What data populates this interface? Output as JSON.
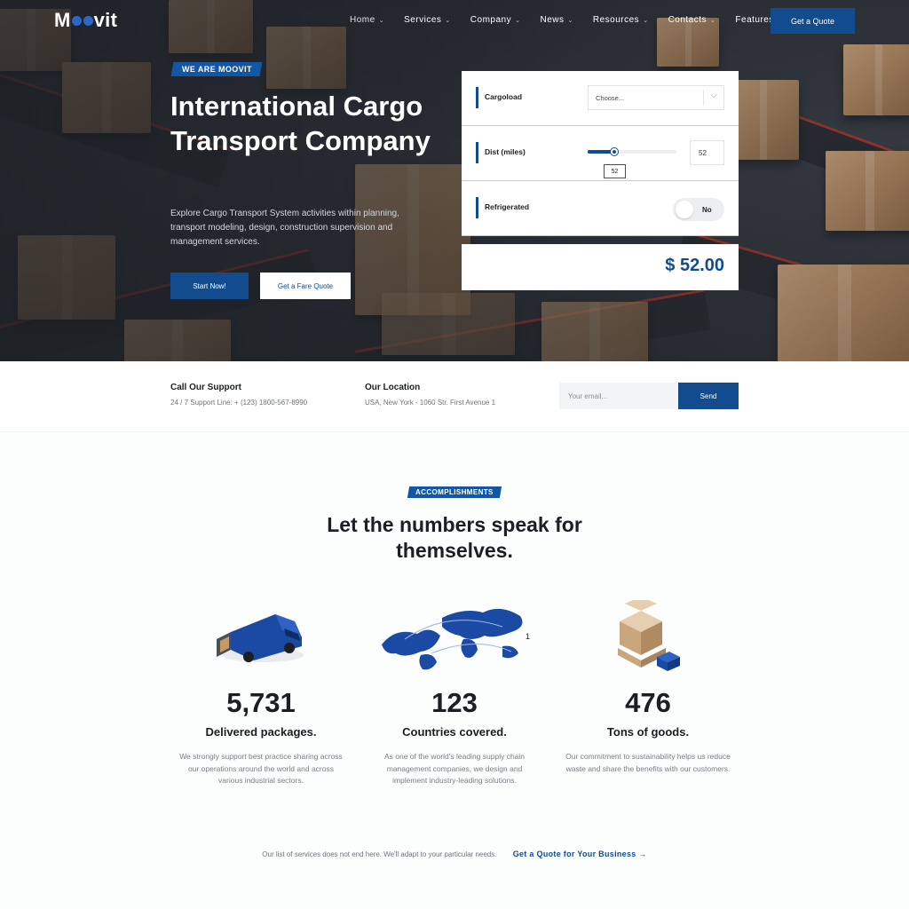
{
  "brand": {
    "logo_prefix": "M",
    "logo_suffix": "vit"
  },
  "nav": {
    "items": [
      {
        "label": "Home"
      },
      {
        "label": "Services"
      },
      {
        "label": "Company"
      },
      {
        "label": "News"
      },
      {
        "label": "Resources"
      },
      {
        "label": "Contacts"
      },
      {
        "label": "Features"
      }
    ],
    "quote_button": "Get a Quote"
  },
  "hero": {
    "tag": "WE ARE MOOVIT",
    "title": "International Cargo Transport Company",
    "description": "Explore Cargo Transport System activities within planning, transport modeling, design, construction supervision and management services.",
    "start_button": "Start Now!",
    "fare_button": "Get a Fare Quote"
  },
  "calculator": {
    "cargoload_label": "Cargoload",
    "cargoload_value": "Choose...",
    "distance_label": "Dist (miles)",
    "distance_value": "52",
    "distance_fraction": 0.3,
    "refrigerated_label": "Refrigerated",
    "refrigerated_value": "No",
    "total": "$ 52.00"
  },
  "info": {
    "support_title": "Call Our Support",
    "support_text": "24 / 7 Support Line: + (123) 1800-567-8990",
    "location_title": "Our Location",
    "location_text": "USA, New York - 1060 Str. First Avenue 1",
    "email_placeholder": "Your email...",
    "send_button": "Send"
  },
  "accomplishments": {
    "tag": "ACCOMPLISHMENTS",
    "title": "Let the numbers speak for themselves.",
    "stats": [
      {
        "number": "5,731",
        "label": "Delivered packages.",
        "description": "We strongly support best practice sharing across our operations around the world and across various industrial sectors.",
        "icon": "delivery-van-icon"
      },
      {
        "number": "123",
        "label": "Countries covered.",
        "description": "As one of the world's leading supply chain management companies, we design and implement industry-leading solutions.",
        "icon": "world-map-icon"
      },
      {
        "number": "476",
        "label": "Tons of goods.",
        "description": "Our commitment to sustainability helps us reduce waste and share the benefits with our customers.",
        "icon": "boxes-pallet-icon"
      }
    ],
    "footer_text": "Our list of services does not end here. We'll adapt to your particular needs.",
    "footer_cta": "Get a Quote for Your Business →"
  },
  "colors": {
    "accent": "#124c8f",
    "tag": "#1256a4"
  }
}
